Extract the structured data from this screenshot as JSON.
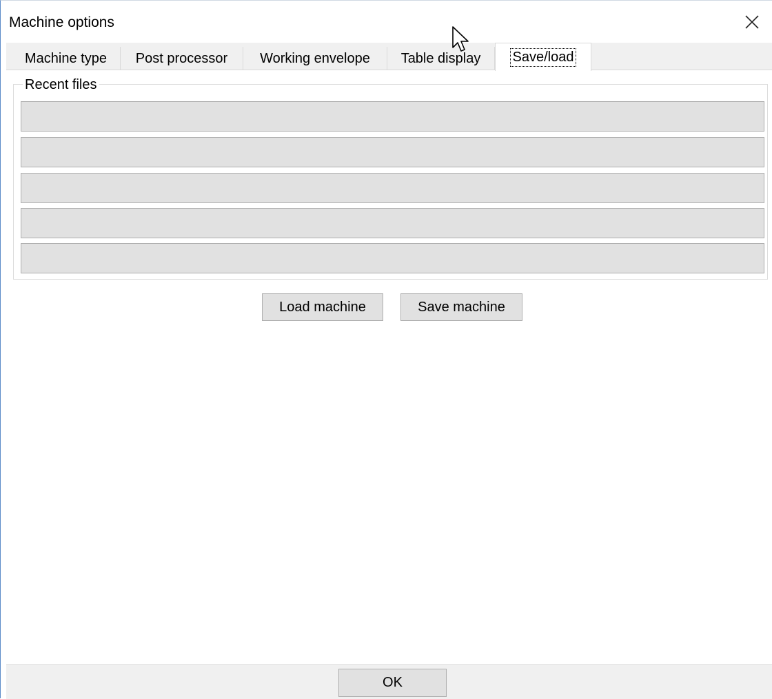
{
  "window": {
    "title": "Machine options"
  },
  "tabs": [
    {
      "label": "Machine type",
      "active": false
    },
    {
      "label": "Post processor",
      "active": false
    },
    {
      "label": "Working envelope",
      "active": false
    },
    {
      "label": "Table display",
      "active": false
    },
    {
      "label": "Save/load",
      "active": true
    }
  ],
  "recent_files": {
    "label": "Recent files",
    "items": [
      "",
      "",
      "",
      "",
      ""
    ]
  },
  "actions": {
    "load_label": "Load machine",
    "save_label": "Save machine"
  },
  "footer": {
    "ok_label": "OK"
  },
  "icons": {
    "close": "close-icon",
    "cursor": "mouse-pointer-icon"
  },
  "colors": {
    "window_border": "#5a8ac8",
    "button_face": "#e1e1e1",
    "tabstrip_bg": "#f0f0f0"
  }
}
